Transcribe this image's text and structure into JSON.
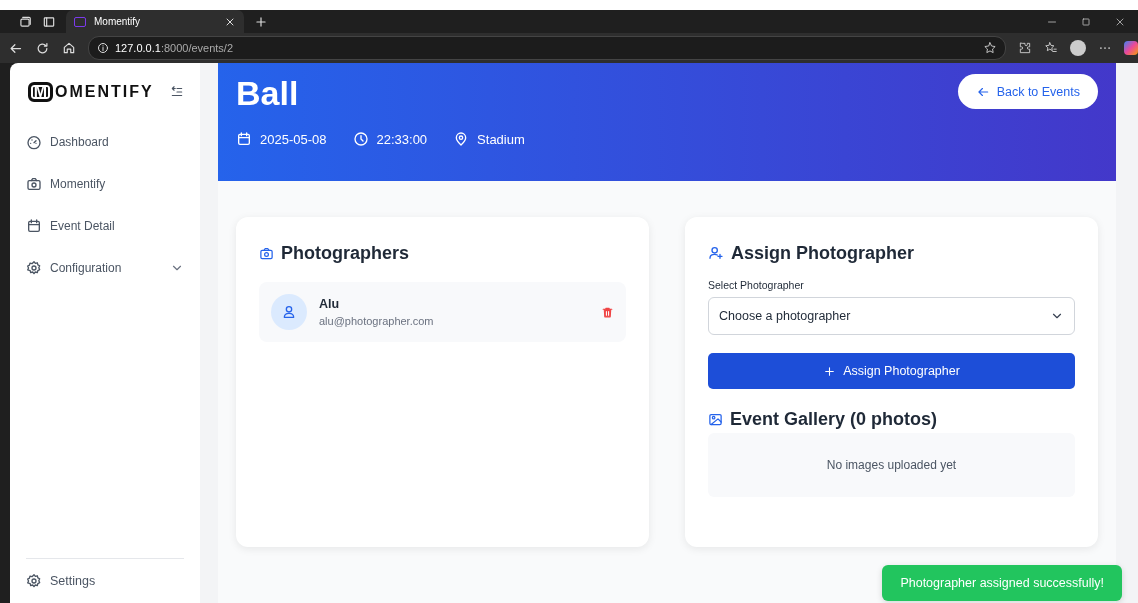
{
  "browser": {
    "tab_title": "Momentify",
    "url_host": "127.0.0.1",
    "url_path": ":8000/events/2"
  },
  "sidebar": {
    "logo_mark": "M",
    "logo_text": "OMENTIFY",
    "items": [
      {
        "label": "Dashboard"
      },
      {
        "label": "Momentify"
      },
      {
        "label": "Event Detail"
      },
      {
        "label": "Configuration",
        "expanded": false
      }
    ],
    "footer": {
      "label": "Settings"
    }
  },
  "event": {
    "title": "Ball",
    "date": "2025-05-08",
    "time": "22:33:00",
    "location": "Stadium",
    "back_button": "Back to Events"
  },
  "photographers": {
    "title": "Photographers",
    "list": [
      {
        "name": "Alu",
        "email": "alu@photographer.com"
      }
    ]
  },
  "assign": {
    "title": "Assign Photographer",
    "field_label": "Select Photographer",
    "select_value": "Choose a photographer",
    "button": "Assign Photographer"
  },
  "gallery": {
    "title": "Event Gallery (0 photos)",
    "empty_text": "No images uploaded yet"
  },
  "toast": {
    "message": "Photographer assigned successfully!"
  }
}
